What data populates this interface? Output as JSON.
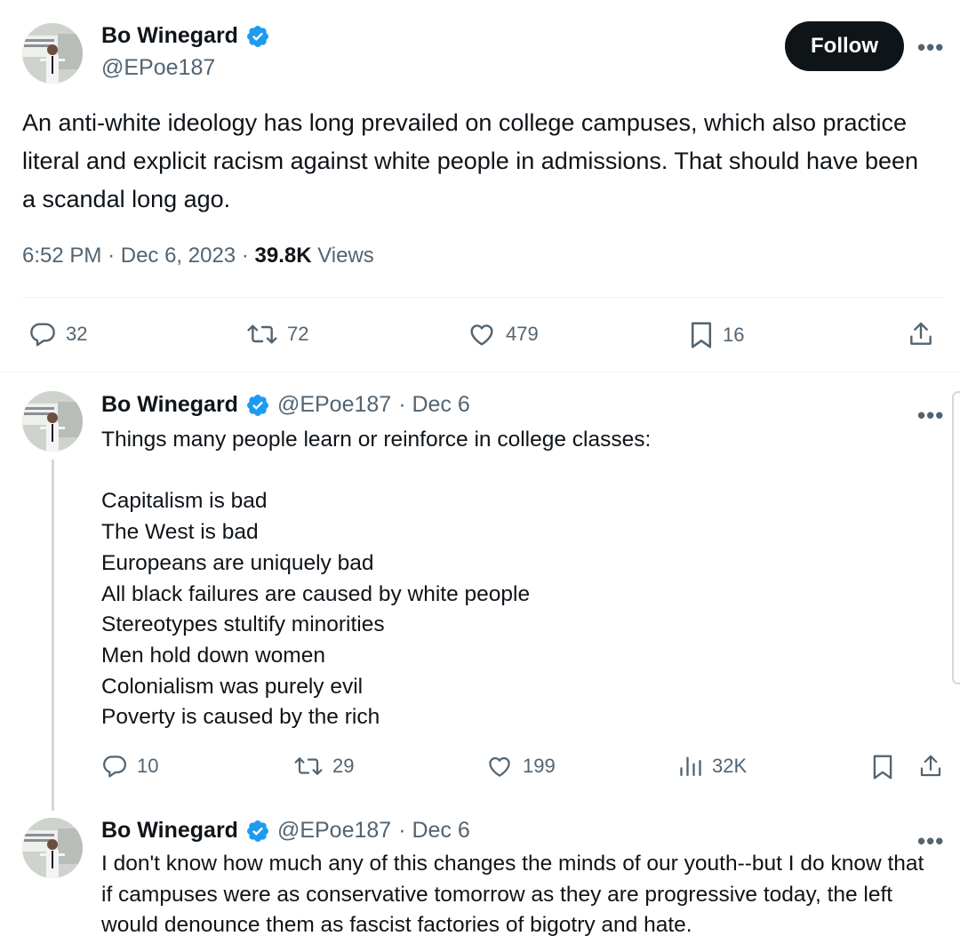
{
  "main_tweet": {
    "author_name": "Bo Winegard",
    "author_handle": "@EPoe187",
    "follow_label": "Follow",
    "more_label": "•••",
    "text": "An anti-white ideology has long prevailed on college campuses, which also practice literal and explicit racism against white people in admissions. That should have been a scandal long ago.",
    "time": "6:52 PM",
    "date": "Dec 6, 2023",
    "views_count": "39.8K",
    "views_label": "Views",
    "separator": "·",
    "replies": "32",
    "reposts": "72",
    "likes": "479",
    "bookmarks": "16"
  },
  "reply1": {
    "author_name": "Bo Winegard",
    "author_handle": "@EPoe187",
    "date": "· Dec 6",
    "more_label": "•••",
    "text": "Things many people learn or reinforce in college classes:\n\nCapitalism is bad\nThe West is bad\nEuropeans are uniquely bad\nAll black failures are caused by white people\nStereotypes stultify minorities\nMen hold down women\nColonialism was purely evil\nPoverty is caused by the rich",
    "replies": "10",
    "reposts": "29",
    "likes": "199",
    "views": "32K"
  },
  "reply2": {
    "author_name": "Bo Winegard",
    "author_handle": "@EPoe187",
    "date": "· Dec 6",
    "more_label": "•••",
    "text": "I don't know how much any of this changes the minds of our youth--but I do know that if campuses were as conservative tomorrow as they are progressive today, the left would denounce them as fascist factories of bigotry and hate."
  },
  "colors": {
    "verified": "#1d9bf0",
    "text": "#0f1419",
    "secondary": "#536471",
    "thread_line": "#cfd9de"
  },
  "icons": [
    "verified-badge-icon",
    "reply-icon",
    "repost-icon",
    "like-icon",
    "bookmark-icon",
    "share-icon",
    "views-icon"
  ]
}
